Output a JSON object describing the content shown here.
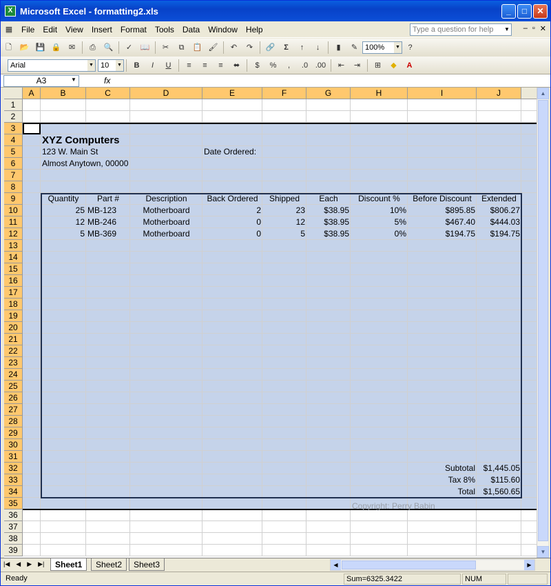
{
  "window": {
    "title": "Microsoft Excel - formatting2.xls"
  },
  "menu": [
    "File",
    "Edit",
    "View",
    "Insert",
    "Format",
    "Tools",
    "Data",
    "Window",
    "Help"
  ],
  "help_placeholder": "Type a question for help",
  "toolbar": {
    "zoom": "100%",
    "font": "Arial",
    "size": "10"
  },
  "formula": {
    "namebox": "A3",
    "fx": "fx",
    "content": ""
  },
  "columns": [
    "A",
    "B",
    "C",
    "D",
    "E",
    "F",
    "G",
    "H",
    "I",
    "J"
  ],
  "rows": [
    "1",
    "2",
    "3",
    "4",
    "5",
    "6",
    "7",
    "8",
    "9",
    "10",
    "11",
    "12",
    "13",
    "14",
    "15",
    "16",
    "17",
    "18",
    "19",
    "20",
    "21",
    "22",
    "23",
    "24",
    "25",
    "26",
    "27",
    "28",
    "29",
    "30",
    "31",
    "32",
    "33",
    "34",
    "35",
    "36",
    "37",
    "38",
    "39"
  ],
  "company": {
    "name": "XYZ Computers",
    "address1": "123 W. Main St",
    "address2": "Almost Anytown, 00000",
    "date_label": "Date Ordered:"
  },
  "table": {
    "headers": [
      "Quantity",
      "Part #",
      "Description",
      "Back Ordered",
      "Shipped",
      "Each",
      "Discount %",
      "Before Discount",
      "Extended"
    ],
    "rows": [
      [
        "25",
        "MB-123",
        "Motherboard",
        "2",
        "23",
        "$38.95",
        "10%",
        "$895.85",
        "$806.27"
      ],
      [
        "12",
        "MB-246",
        "Motherboard",
        "0",
        "12",
        "$38.95",
        "5%",
        "$467.40",
        "$444.03"
      ],
      [
        "5",
        "MB-369",
        "Motherboard",
        "0",
        "5",
        "$38.95",
        "0%",
        "$194.75",
        "$194.75"
      ]
    ],
    "subtotal_label": "Subtotal",
    "subtotal": "$1,445.05",
    "tax_label": "Tax 8%",
    "tax": "$115.60",
    "total_label": "Total",
    "total": "$1,560.65"
  },
  "copyright": "Copyright: Perry Babin",
  "sheets": [
    "Sheet1",
    "Sheet2",
    "Sheet3"
  ],
  "status": {
    "ready": "Ready",
    "sum": "Sum=6325.3422",
    "num": "NUM"
  }
}
